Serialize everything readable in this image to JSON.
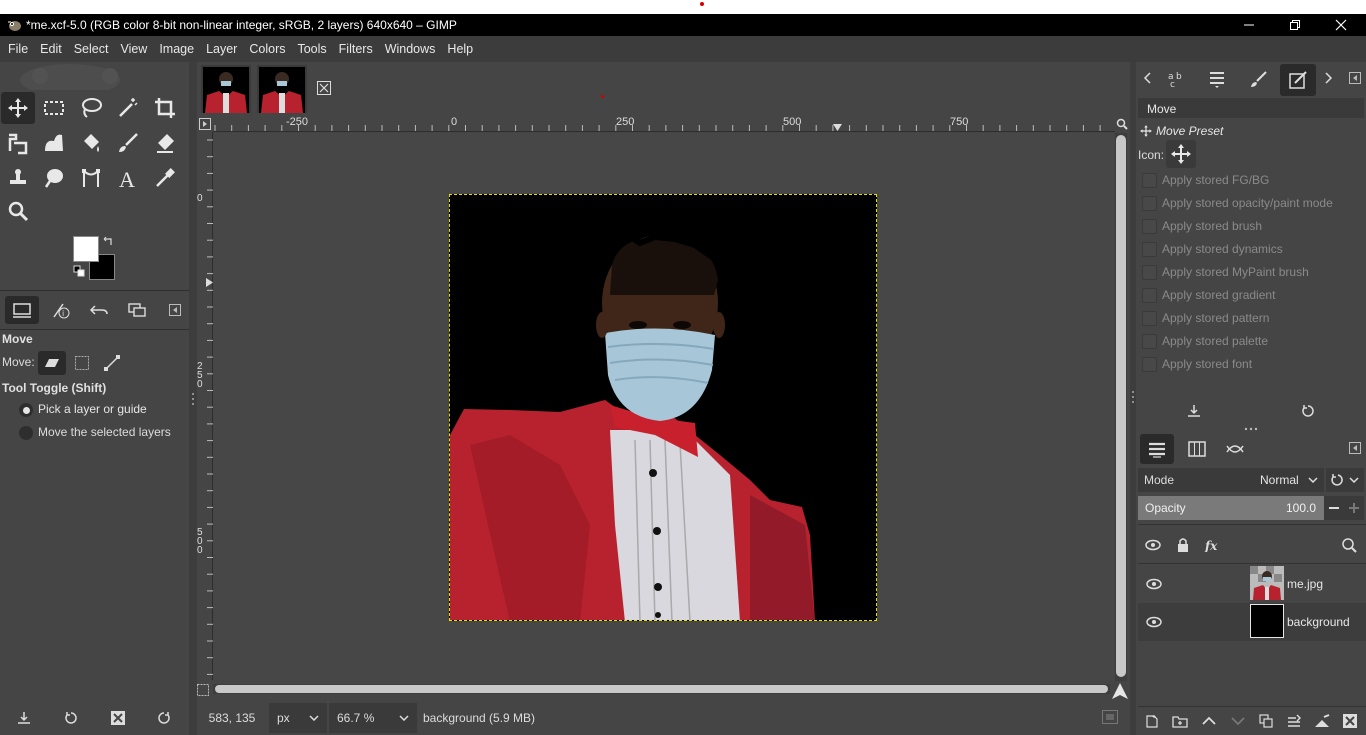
{
  "window": {
    "title": "*me.xcf-5.0 (RGB color 8-bit non-linear integer, sRGB, 2 layers) 640x640 – GIMP"
  },
  "menu": [
    "File",
    "Edit",
    "Select",
    "View",
    "Image",
    "Layer",
    "Colors",
    "Tools",
    "Filters",
    "Windows",
    "Help"
  ],
  "tool_options": {
    "title": "Move",
    "move_label": "Move:",
    "toggle_label": "Tool Toggle  (Shift)",
    "radio_options": [
      "Pick a layer or guide",
      "Move the selected layers"
    ],
    "selected_option": "Pick a layer or guide"
  },
  "rulers": {
    "h_ticks": [
      "-250",
      "0",
      "250",
      "500",
      "750"
    ],
    "v_ticks": [
      "0",
      "250",
      "500"
    ]
  },
  "status": {
    "coords": "583, 135",
    "unit": "px",
    "zoom": "66.7 %",
    "message": "background (5.9 MB)"
  },
  "device_status": {
    "preset_name": "Move",
    "preset_title": "Move Preset",
    "icon_label": "Icon:",
    "options": [
      "Apply stored FG/BG",
      "Apply stored opacity/paint mode",
      "Apply stored brush",
      "Apply stored dynamics",
      "Apply stored MyPaint brush",
      "Apply stored gradient",
      "Apply stored pattern",
      "Apply stored palette",
      "Apply stored font"
    ]
  },
  "layers": {
    "mode_label": "Mode",
    "mode_value": "Normal",
    "opacity_label": "Opacity",
    "opacity_value": "100.0",
    "items": [
      {
        "name": "me.jpg",
        "visible": true
      },
      {
        "name": "background",
        "visible": true
      }
    ]
  },
  "colors": {
    "foreground": "#ffffff",
    "background": "#000000",
    "suit": "#b8222e",
    "selection_border": "#e6e000"
  }
}
